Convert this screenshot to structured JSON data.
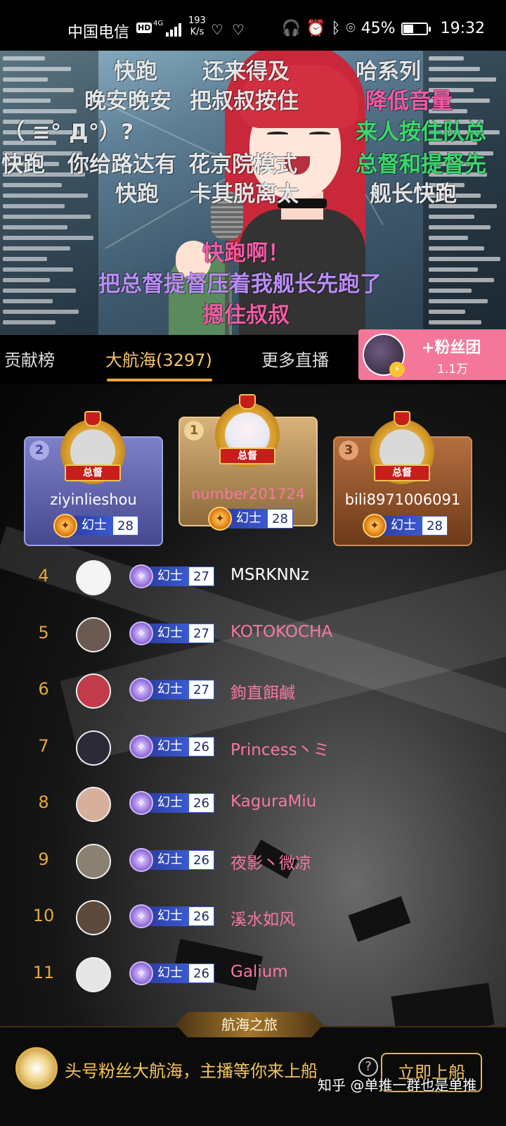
{
  "status_bar": {
    "carrier": "中国电信",
    "hd": "HD",
    "net_type": "4G",
    "speed_value": "193",
    "speed_unit": "K/s",
    "battery_percent": "45%",
    "battery_level": 0.45,
    "time": "19:32"
  },
  "video": {
    "danmaku": [
      {
        "text": "快跑",
        "color": "white"
      },
      {
        "text": "还来得及",
        "color": "white"
      },
      {
        "text": "哈系列",
        "color": "white"
      },
      {
        "text": "晚安晚安",
        "color": "white"
      },
      {
        "text": "把叔叔按住",
        "color": "white"
      },
      {
        "text": "降低音量",
        "color": "pink"
      },
      {
        "text": "（ ≡° Д°）?",
        "color": "white"
      },
      {
        "text": "来人按住队总",
        "color": "green"
      },
      {
        "text": "快跑",
        "color": "white"
      },
      {
        "text": "你给路达有",
        "color": "white"
      },
      {
        "text": "花京院模式",
        "color": "white"
      },
      {
        "text": "总督和提督先",
        "color": "green"
      },
      {
        "text": "快跑",
        "color": "white"
      },
      {
        "text": "卡其脱离太",
        "color": "white"
      },
      {
        "text": "舰长快跑",
        "color": "white"
      },
      {
        "text": "快跑啊！",
        "color": "pink"
      },
      {
        "text": "把总督提督压着我舰长先跑了",
        "color": "purple"
      },
      {
        "text": "摁住叔叔",
        "color": "pink"
      }
    ]
  },
  "tabs": [
    {
      "label": "贡献榜",
      "active": false
    },
    {
      "label": "大航海(3297)",
      "active": true
    },
    {
      "label": "更多直播",
      "active": false
    }
  ],
  "fan_club": {
    "label": "+粉丝团",
    "count": "1.1万"
  },
  "podium": [
    {
      "rank": "2",
      "name": "ziyinlieshou",
      "title": "总督",
      "badge_label": "幻士",
      "badge_level": "28"
    },
    {
      "rank": "1",
      "name": "number201724",
      "title": "总督",
      "badge_label": "幻士",
      "badge_level": "28"
    },
    {
      "rank": "3",
      "name": "bili8971006091",
      "title": "总督",
      "badge_label": "幻士",
      "badge_level": "28"
    }
  ],
  "rows": [
    {
      "rank": "4",
      "name": "MSRKNNz",
      "badge_label": "幻士",
      "badge_level": "27",
      "name_color": "#ffffff"
    },
    {
      "rank": "5",
      "name": "KOTOKOCHA",
      "badge_label": "幻士",
      "badge_level": "27",
      "name_color": "#f5799f"
    },
    {
      "rank": "6",
      "name": "鉤直餌鹹",
      "badge_label": "幻士",
      "badge_level": "27",
      "name_color": "#f5799f"
    },
    {
      "rank": "7",
      "name": "Princess丶ミ",
      "badge_label": "幻士",
      "badge_level": "26",
      "name_color": "#f5799f"
    },
    {
      "rank": "8",
      "name": "KaguraMiu",
      "badge_label": "幻士",
      "badge_level": "26",
      "name_color": "#f5799f"
    },
    {
      "rank": "9",
      "name": "夜影丶微凉",
      "badge_label": "幻士",
      "badge_level": "26",
      "name_color": "#f5799f"
    },
    {
      "rank": "10",
      "name": "溪水如风",
      "badge_label": "幻士",
      "badge_level": "26",
      "name_color": "#f5799f"
    },
    {
      "rank": "11",
      "name": "Galium",
      "badge_label": "幻士",
      "badge_level": "26",
      "name_color": "#f5799f"
    }
  ],
  "bottom": {
    "voyage_tab": "航海之旅",
    "promo_text": "头号粉丝大航海，主播等你来上船",
    "help": "?",
    "board_button": "立即上船",
    "watermark": "知乎 @单推一群也是单推"
  },
  "colors": {
    "accent_gold": "#f6c56a",
    "fan_pink": "#f4779a",
    "name_pink": "#f5799f",
    "rank_orange": "#e7a83d"
  }
}
